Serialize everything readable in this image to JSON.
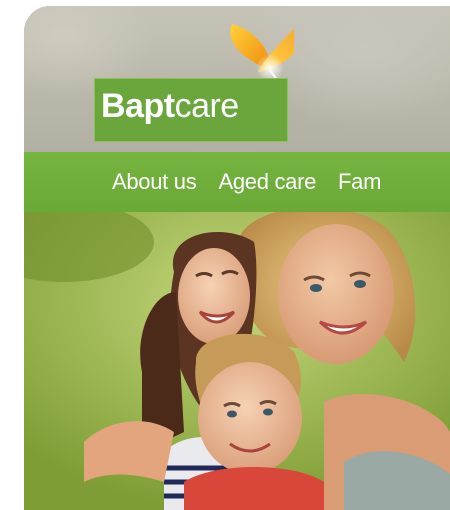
{
  "brand": {
    "name_part_bold": "Bapt",
    "name_part_regular": "care",
    "logo_color": "#6aa63b",
    "leaf_color": "#f5a623"
  },
  "nav": {
    "items": [
      {
        "label": "About us"
      },
      {
        "label": "Aged care"
      },
      {
        "label": "Fam"
      }
    ],
    "bar_color": "#6fae3a"
  },
  "hero": {
    "image_icon": "family-photo",
    "subjects": "mother, daughter and son smiling outdoors"
  }
}
